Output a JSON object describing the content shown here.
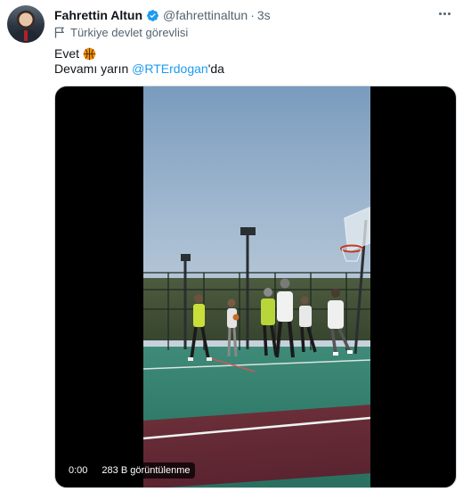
{
  "author": {
    "name": "Fahrettin Altun",
    "handle": "@fahrettinaltun",
    "time": "3s",
    "label": "Türkiye devlet görevlisi"
  },
  "tweet": {
    "line1": "Evet",
    "line2_prefix": "Devamı yarın ",
    "mention": "@RTErdogan",
    "line2_suffix": "'da"
  },
  "media": {
    "timestamp": "0:00",
    "views": "283 B görüntülenme"
  },
  "colors": {
    "accent": "#1d9bf0",
    "text": "#0f1419",
    "muted": "#536471"
  },
  "icons": {
    "verified": "verified-badge-icon",
    "label": "flag-icon",
    "emoji": "basketball-icon",
    "menu": "more-icon"
  }
}
